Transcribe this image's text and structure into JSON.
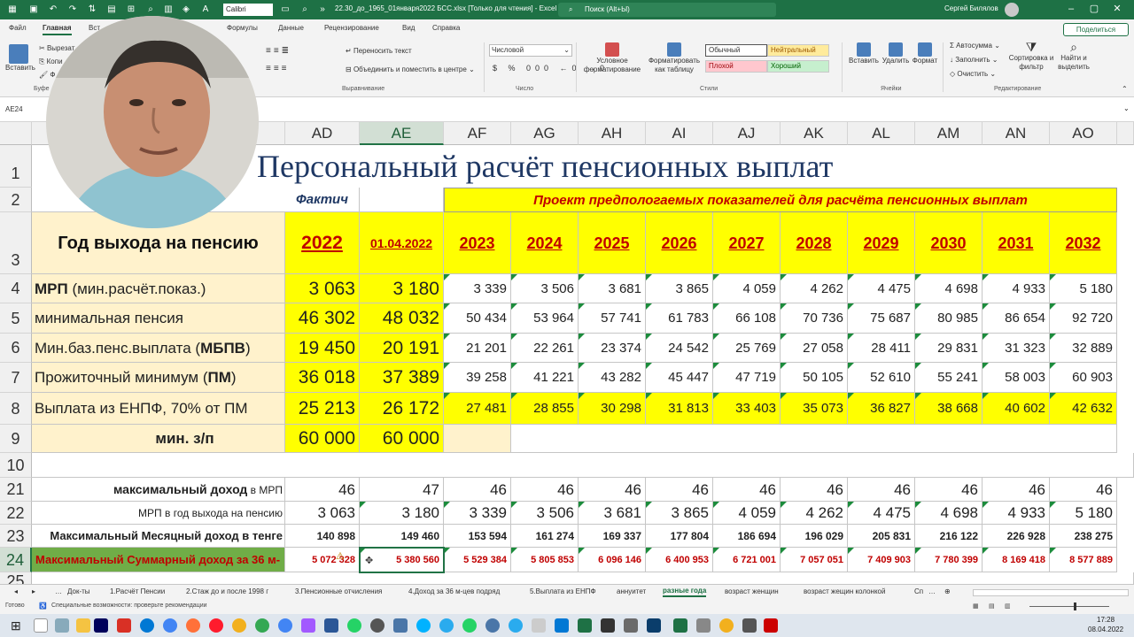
{
  "titlebar": {
    "font": "Calibri",
    "document": "22.30_до_1965_01января2022 БСС.xlsx [Только для чтения] - Excel",
    "search": "Поиск (Alt+Ы)",
    "user": "Сергей Билялов"
  },
  "ribbon_tabs": [
    "Файл",
    "Главная",
    "Вст",
    "Формулы",
    "Данные",
    "Рецензирование",
    "Вид",
    "Справка"
  ],
  "share": "Поделиться",
  "ribbon": {
    "paste": "Вставить",
    "cut": "Вырезат",
    "copy": "Копи",
    "format_painter": "Ф",
    "clipboard": "Буфе",
    "wrap": "Переносить текст",
    "merge": "Объединить и поместить в центре",
    "alignment": "Выравнивание",
    "numfmt": "Числовой",
    "number": "Число",
    "cond": "Условное форматирование",
    "table": "Форматировать как таблицу",
    "style_normal": "Обычный",
    "style_neutral": "Нейтральный",
    "style_bad": "Плохой",
    "style_good": "Хороший",
    "styles": "Стили",
    "insert": "Вставить",
    "delete": "Удалить",
    "format": "Формат",
    "cells": "Ячейки",
    "autosum": "Автосумма",
    "fill": "Заполнить",
    "clear": "Очистить",
    "sort": "Сортировка и фильтр",
    "find": "Найти и выделить",
    "editing": "Редактирование"
  },
  "namebox": "AE24",
  "columns": [
    "AD",
    "AE",
    "AF",
    "AG",
    "AH",
    "AI",
    "AJ",
    "AK",
    "AL",
    "AM",
    "AN",
    "AO"
  ],
  "rows": [
    "1",
    "2",
    "3",
    "4",
    "5",
    "6",
    "7",
    "8",
    "9",
    "10",
    "21",
    "22",
    "23",
    "24",
    "25"
  ],
  "sheet": {
    "title": "Персональный расчёт пенсионных выплат",
    "fact": "Фактич",
    "project": "Проект предпологаемых показателей для расчёта пенсионных выплат",
    "year_label": "Год выхода на пенсию",
    "years": [
      "2022",
      "01.04.2022",
      "2023",
      "2024",
      "2025",
      "2026",
      "2027",
      "2028",
      "2029",
      "2030",
      "2031",
      "2032"
    ],
    "labels": {
      "mrp": "МРП",
      "mrp_tail": " (мин.расчёт.показ.)",
      "minpens": "минимальная пенсия",
      "mbpv": "Мин.баз.пенс.выплата (",
      "mbpv_b": "МБПВ",
      "mbpv_end": ")",
      "pm": "Прожиточный минимум (",
      "pm_b": "ПМ",
      "pm_end": ")",
      "enpf": "Выплата из ЕНПФ, 70% от ПМ",
      "minzp": "мин. з/п",
      "maxinc": "максимальный доход",
      "maxinc_tail": " в МРП",
      "mrpyear": "МРП в год выхода на пенсию",
      "maxmonth": "Максимальный Месяцный доход в тенге",
      "maxsum": "Максимальный Суммарный доход за 36 м-"
    },
    "row4": [
      "3 063",
      "3 180",
      "3 339",
      "3 506",
      "3 681",
      "3 865",
      "4 059",
      "4 262",
      "4 475",
      "4 698",
      "4 933",
      "5 180"
    ],
    "row5": [
      "46 302",
      "48 032",
      "50 434",
      "53 964",
      "57 741",
      "61 783",
      "66 108",
      "70 736",
      "75 687",
      "80 985",
      "86 654",
      "92 720"
    ],
    "row6": [
      "19 450",
      "20 191",
      "21 201",
      "22 261",
      "23 374",
      "24 542",
      "25 769",
      "27 058",
      "28 411",
      "29 831",
      "31 323",
      "32 889"
    ],
    "row7": [
      "36 018",
      "37 389",
      "39 258",
      "41 221",
      "43 282",
      "45 447",
      "47 719",
      "50 105",
      "52 610",
      "55 241",
      "58 003",
      "60 903"
    ],
    "row8": [
      "25 213",
      "26 172",
      "27 481",
      "28 855",
      "30 298",
      "31 813",
      "33 403",
      "35 073",
      "36 827",
      "38 668",
      "40 602",
      "42 632"
    ],
    "row9": [
      "60 000",
      "60 000"
    ],
    "row21": [
      "46",
      "47",
      "46",
      "46",
      "46",
      "46",
      "46",
      "46",
      "46",
      "46",
      "46",
      "46"
    ],
    "row22": [
      "3 063",
      "3 180",
      "3 339",
      "3 506",
      "3 681",
      "3 865",
      "4 059",
      "4 262",
      "4 475",
      "4 698",
      "4 933",
      "5 180"
    ],
    "row23": [
      "140 898",
      "149 460",
      "153 594",
      "161 274",
      "169 337",
      "177 804",
      "186 694",
      "196 029",
      "205 831",
      "216 122",
      "226 928",
      "238 275"
    ],
    "row24": [
      "5 072 328",
      "5 380 560",
      "5 529 384",
      "5 805 853",
      "6 096 146",
      "6 400 953",
      "6 721 001",
      "7 057 051",
      "7 409 903",
      "7 780 399",
      "8 169 418",
      "8 577 889"
    ]
  },
  "sheet_tabs": [
    "Док-ты",
    "1.Расчёт Пенсии",
    "2.Стаж до и после 1998 г",
    "3.Пенсионные отчисления",
    "4.Доход за 36 м-цев подряд",
    "5.Выплата из ЕНПФ",
    "аннуитет",
    "разные года",
    "возраст женщин",
    "возраст жещин колонкой",
    "Сп"
  ],
  "status": {
    "ready": "Готово",
    "accessibility": "Специальные возможности: проверьте рекомендации"
  },
  "clock": {
    "time": "17:28",
    "date": "08.04.2022"
  },
  "colors": {
    "excel_green": "#1e7145",
    "yellow": "#ffff00",
    "light_yellow": "#fff2cc",
    "dark_red": "#c00000",
    "row24_fill": "#70ad47",
    "title_blue": "#1f3864"
  }
}
